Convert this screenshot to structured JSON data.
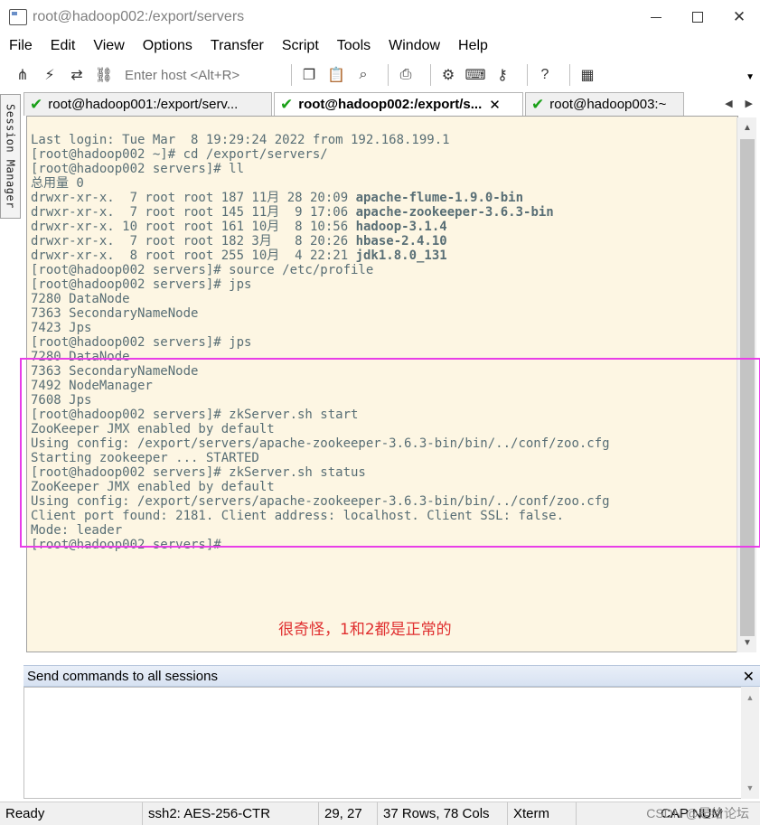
{
  "window": {
    "title": "root@hadoop002:/export/servers"
  },
  "menu": [
    "File",
    "Edit",
    "View",
    "Options",
    "Transfer",
    "Script",
    "Tools",
    "Window",
    "Help"
  ],
  "toolbar": {
    "host_placeholder": "Enter host <Alt+R>"
  },
  "session_manager": {
    "label": "Session Manager"
  },
  "tabs": [
    {
      "label": "root@hadoop001:/export/serv...",
      "status": "connected"
    },
    {
      "label": "root@hadoop002:/export/s...",
      "status": "connected",
      "active": true
    },
    {
      "label": "root@hadoop003:~",
      "status": "connected"
    }
  ],
  "terminal": {
    "lines": [
      "Last login: Tue Mar  8 19:29:24 2022 from 192.168.199.1",
      "[root@hadoop002 ~]# cd /export/servers/",
      "[root@hadoop002 servers]# ll",
      "总用量 0",
      "drwxr-xr-x.  7 root root 187 11月 28 20:09 ",
      "drwxr-xr-x.  7 root root 145 11月  9 17:06 ",
      "drwxr-xr-x. 10 root root 161 10月  8 10:56 ",
      "drwxr-xr-x.  7 root root 182 3月   8 20:26 ",
      "drwxr-xr-x.  8 root root 255 10月  4 22:21 ",
      "[root@hadoop002 servers]# source /etc/profile",
      "[root@hadoop002 servers]# jps",
      "7280 DataNode",
      "7363 SecondaryNameNode",
      "7423 Jps",
      "[root@hadoop002 servers]# jps",
      "7280 DataNode",
      "7363 SecondaryNameNode",
      "7492 NodeManager",
      "7608 Jps",
      "[root@hadoop002 servers]# zkServer.sh start",
      "ZooKeeper JMX enabled by default",
      "Using config: /export/servers/apache-zookeeper-3.6.3-bin/bin/../conf/zoo.cfg",
      "Starting zookeeper ... STARTED",
      "[root@hadoop002 servers]# zkServer.sh status",
      "ZooKeeper JMX enabled by default",
      "Using config: /export/servers/apache-zookeeper-3.6.3-bin/bin/../conf/zoo.cfg",
      "Client port found: 2181. Client address: localhost. Client SSL: false.",
      "Mode: leader",
      "[root@hadoop002 servers]# "
    ],
    "dir_names": [
      "apache-flume-1.9.0-bin",
      "apache-zookeeper-3.6.3-bin",
      "hadoop-3.1.4",
      "hbase-2.4.10",
      "jdk1.8.0_131"
    ],
    "background": "#fdf6e3",
    "foreground": "#586e75"
  },
  "annotation": {
    "text": "很奇怪，1和2都是正常的",
    "color": "#e03030"
  },
  "highlight_color": "#e83ee8",
  "send_pane": {
    "label": "Send commands to all sessions"
  },
  "statusbar": {
    "state": "Ready",
    "protocol": "ssh2: AES-256-CTR",
    "cursor": "29, 27",
    "size": "37 Rows, 78 Cols",
    "emulation": "Xterm",
    "keys": "CAP NUM"
  },
  "watermark": "CSDN @是给论坛"
}
